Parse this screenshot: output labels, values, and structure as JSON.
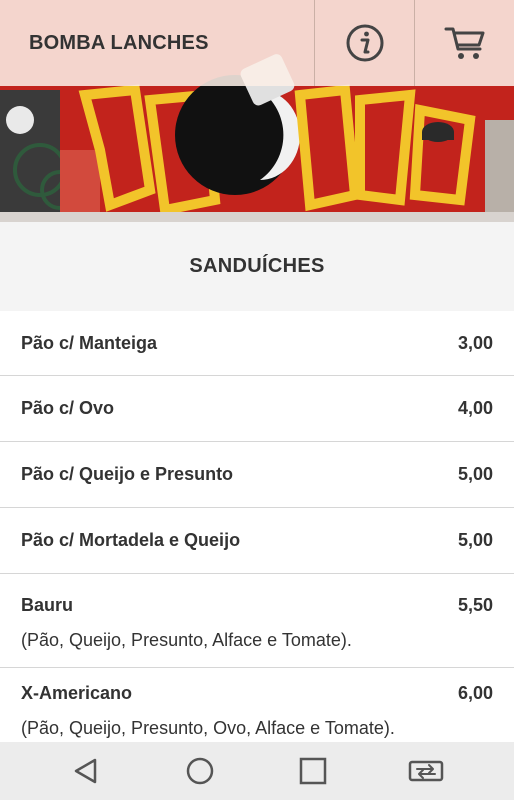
{
  "app": {
    "title": "BOMBA LANCHES"
  },
  "header": {
    "info_icon": "info-circle-icon",
    "cart_icon": "shopping-cart-icon"
  },
  "section": {
    "title": "SANDUÍCHES"
  },
  "items": [
    {
      "name": "Pão c/ Manteiga",
      "price": "3,00",
      "description": ""
    },
    {
      "name": "Pão c/ Ovo",
      "price": "4,00",
      "description": ""
    },
    {
      "name": "Pão c/ Queijo e Presunto",
      "price": "5,00",
      "description": ""
    },
    {
      "name": "Pão c/ Mortadela e Queijo",
      "price": "5,00",
      "description": ""
    },
    {
      "name": "Bauru",
      "price": "5,50",
      "description": "(Pão, Queijo, Presunto, Alface e Tomate)."
    },
    {
      "name": "X-Americano",
      "price": "6,00",
      "description": "(Pão, Queijo, Presunto, Ovo, Alface e Tomate)."
    }
  ],
  "navigation": {
    "back_icon": "back-triangle-icon",
    "home_icon": "home-circle-icon",
    "recents_icon": "recents-square-icon",
    "switch_icon": "app-switch-icon"
  },
  "colors": {
    "banner_red": "#c2231c",
    "graffiti_yellow": "#f2c42a",
    "header_overlay": "#faeee6",
    "section_bg": "#f4f4f4",
    "navbar_bg": "#ececec"
  }
}
